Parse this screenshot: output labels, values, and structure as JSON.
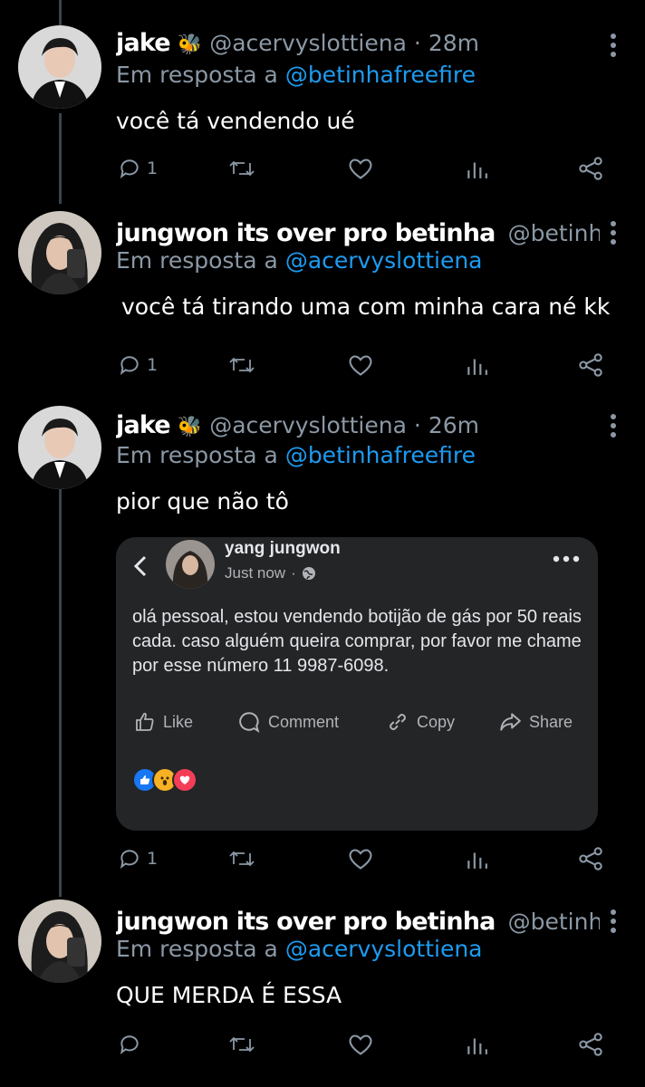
{
  "tweets": [
    {
      "name": "jake",
      "badge": "🐝",
      "handle": "@acervyslottiena",
      "time": "· 28m",
      "reply_prefix": "Em resposta a",
      "reply_to": "@betinhafreefire",
      "text": "você tá vendendo ué",
      "reply_count": "1",
      "retweet_count": "",
      "like_count": ""
    },
    {
      "name": "jungwon its over pro betinha",
      "badge": "",
      "handle": "@betinha...",
      "time": "",
      "reply_prefix": "Em resposta a",
      "reply_to": "@acervyslottiena",
      "text": "você tá tirando uma com minha cara né kk",
      "reply_count": "1",
      "retweet_count": "",
      "like_count": ""
    },
    {
      "name": "jake",
      "badge": "🐝",
      "handle": "@acervyslottiena",
      "time": "· 26m",
      "reply_prefix": "Em resposta a",
      "reply_to": "@betinhafreefire",
      "text": "pior que não tô",
      "reply_count": "1",
      "retweet_count": "",
      "like_count": ""
    },
    {
      "name": "jungwon its over pro betinha",
      "badge": "",
      "handle": "@betinha...",
      "time": "",
      "reply_prefix": "Em resposta a",
      "reply_to": "@acervyslottiena",
      "text": "QUE MERDA É ESSA",
      "reply_count": "",
      "retweet_count": "",
      "like_count": ""
    }
  ],
  "embedded_post": {
    "author": "yang jungwon",
    "time": "Just now",
    "privacy_icon": "globe-icon",
    "text": "olá pessoal, estou vendendo botijão de gás por 50 reais cada. caso alguém queira comprar, por favor me chame por esse número 11 9987-6098.",
    "actions": {
      "like": "Like",
      "comment": "Comment",
      "copy": "Copy",
      "share": "Share"
    },
    "reactions": [
      "like",
      "wow",
      "love"
    ]
  },
  "colors": {
    "background": "#000000",
    "secondary_text": "#8b98a5",
    "link": "#1d9bf0",
    "card_background": "#242526",
    "thread_line": "#38444d"
  }
}
